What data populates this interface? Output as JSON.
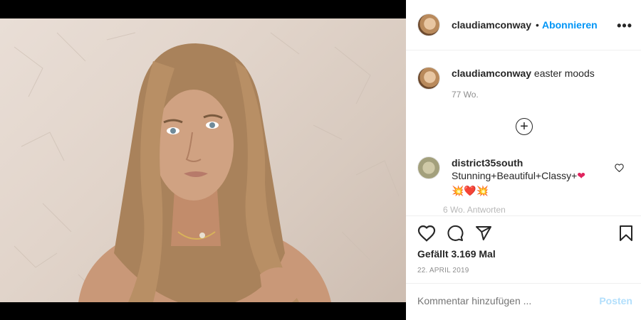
{
  "post": {
    "author": "claudiamconway",
    "follow_label": "Abonnieren",
    "separator": "•",
    "more_label": "•••"
  },
  "caption": {
    "username": "claudiamconway",
    "text": " easter moods",
    "time": "77 Wo."
  },
  "comment": {
    "username": "district35south",
    "text": "Stunning+Beautiful+Classy+",
    "emoji_line": "💥❤️💥",
    "time_faded": "6 Wo.    Antworten"
  },
  "load_more_label": "+",
  "stats": {
    "likes": "Gefällt 3.169 Mal",
    "date": "22. APRIL 2019"
  },
  "comment_box": {
    "placeholder": "Kommentar hinzufügen ...",
    "post_label": "Posten"
  },
  "carousel": {
    "total": 2,
    "active_index": 0
  },
  "colors": {
    "accent": "#0095f6",
    "post_disabled": "#b2dffc",
    "heart": "#ed4956"
  },
  "icons": [
    "heart-icon",
    "comment-icon",
    "share-icon",
    "bookmark-icon",
    "more-icon",
    "plus-circle-icon"
  ]
}
